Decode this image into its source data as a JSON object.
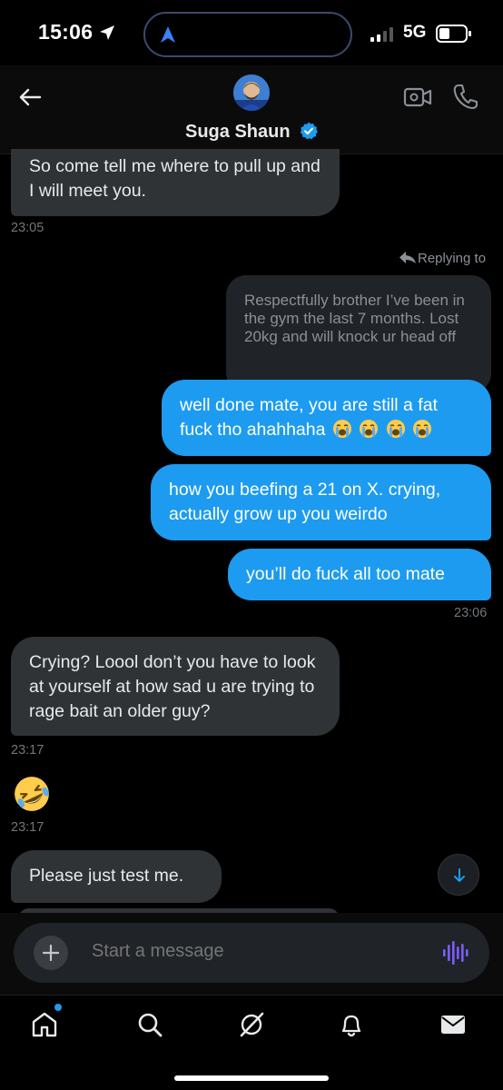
{
  "status_bar": {
    "time": "15:06",
    "network": "5G"
  },
  "header": {
    "contact_name": "Suga Shaun"
  },
  "messages": {
    "m1": "So come tell me where to pull up and I will meet you.",
    "t1": "23:05",
    "replying_to": "Replying to",
    "quoted": "Respectfully brother I’ve been in the gym the last 7 months. Lost 20kg and will knock ur head off",
    "m2_text": "well done mate, you are still a fat fuck tho ahahhaha",
    "m3": "how you beefing a 21 on X. crying, actually grow up you weirdo",
    "m4": "you’ll do fuck all too mate",
    "t2": "23:06",
    "m5": "Crying? Loool don’t you have to look at yourself at how sad u are trying to rage bait an older guy?",
    "t3": "23:17",
    "t4": "23:17",
    "m6": "Please just test me."
  },
  "composer": {
    "placeholder": "Start a message"
  },
  "colors": {
    "accent": "#1d9bf0",
    "bubble_received": "#2f3336",
    "background": "#000000",
    "voice_icon": "#7c5cff"
  },
  "icons": [
    "back-arrow-icon",
    "video-call-icon",
    "phone-icon",
    "verified-badge-icon",
    "plus-icon",
    "voice-icon",
    "home-icon",
    "search-icon",
    "grok-icon",
    "bell-icon",
    "mail-icon"
  ]
}
